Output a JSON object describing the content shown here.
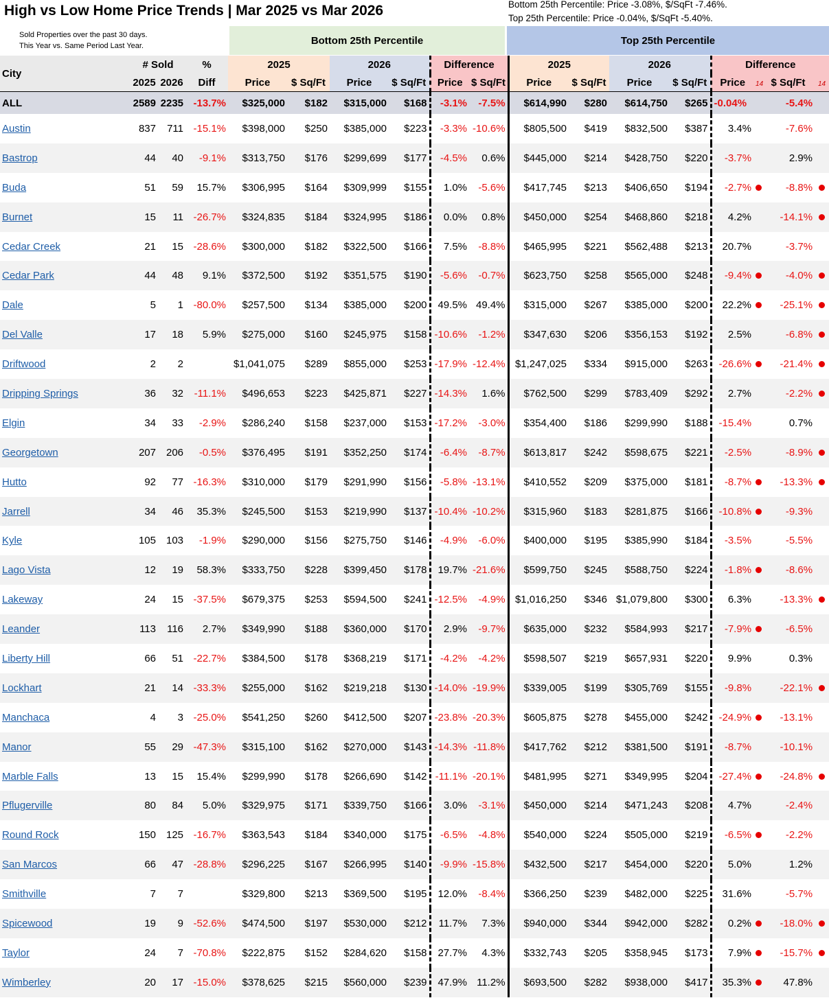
{
  "title": "High vs Low Home Price Trends | Mar 2025 vs Mar 2026",
  "summary": {
    "bottom": "Bottom 25th Percentile: Price -3.08%, $/SqFt -7.46%.",
    "top": "Top 25th Percentile: Price -0.04%, $/SqFt -5.40%."
  },
  "note": {
    "line1": "Sold Properties over the past 30 days.",
    "line2": "This Year vs. Same Period Last Year."
  },
  "bands": {
    "bottom": "Bottom 25th Percentile",
    "top": "Top 25th Percentile"
  },
  "headers": {
    "city": "City",
    "sold": "# Sold",
    "pct": "%",
    "y2025": "2025",
    "y2026": "2026",
    "diff": "Diff",
    "difference": "Difference",
    "price": "Price",
    "sqft": "$ Sq/Ft",
    "flag": "14"
  },
  "colors": {
    "peach": "#fde4d2",
    "blue": "#d6dcea",
    "pink": "#f9c5c7",
    "band_green": "#e2efda",
    "band_blue": "#b4c6e7",
    "link": "#1f5ea8",
    "negative": "#e81515",
    "dot": "#e60000"
  },
  "chart_data": {
    "type": "table",
    "columns": [
      "City",
      "# Sold 2025",
      "# Sold 2026",
      "% Diff",
      "Bottom 2025 Price",
      "Bottom 2025 $ Sq/Ft",
      "Bottom 2026 Price",
      "Bottom 2026 $ Sq/Ft",
      "Bottom Diff Price",
      "Bottom Diff $ Sq/Ft",
      "Top 2025 Price",
      "Top 2025 $ Sq/Ft",
      "Top 2026 Price",
      "Top 2026 $ Sq/Ft",
      "Top Diff Price",
      "Top Diff Price Flag",
      "Top Diff $ Sq/Ft",
      "Top Diff $ Sq/Ft Flag"
    ],
    "all_row": [
      "ALL",
      "2589",
      "2235",
      "-13.7%",
      "$325,000",
      "$182",
      "$315,000",
      "$168",
      "-3.1%",
      "-7.5%",
      "$614,990",
      "$280",
      "$614,750",
      "$265",
      "-0.04%",
      false,
      "-5.4%",
      false
    ],
    "rows": [
      [
        "Austin",
        "837",
        "711",
        "-15.1%",
        "$398,000",
        "$250",
        "$385,000",
        "$223",
        "-3.3%",
        "-10.6%",
        "$805,500",
        "$419",
        "$832,500",
        "$387",
        "3.4%",
        false,
        "-7.6%",
        false
      ],
      [
        "Bastrop",
        "44",
        "40",
        "-9.1%",
        "$313,750",
        "$176",
        "$299,699",
        "$177",
        "-4.5%",
        "0.6%",
        "$445,000",
        "$214",
        "$428,750",
        "$220",
        "-3.7%",
        false,
        "2.9%",
        false
      ],
      [
        "Buda",
        "51",
        "59",
        "15.7%",
        "$306,995",
        "$164",
        "$309,999",
        "$155",
        "1.0%",
        "-5.6%",
        "$417,745",
        "$213",
        "$406,650",
        "$194",
        "-2.7%",
        true,
        "-8.8%",
        true
      ],
      [
        "Burnet",
        "15",
        "11",
        "-26.7%",
        "$324,835",
        "$184",
        "$324,995",
        "$186",
        "0.0%",
        "0.8%",
        "$450,000",
        "$254",
        "$468,860",
        "$218",
        "4.2%",
        false,
        "-14.1%",
        true
      ],
      [
        "Cedar Creek",
        "21",
        "15",
        "-28.6%",
        "$300,000",
        "$182",
        "$322,500",
        "$166",
        "7.5%",
        "-8.8%",
        "$465,995",
        "$221",
        "$562,488",
        "$213",
        "20.7%",
        false,
        "-3.7%",
        false
      ],
      [
        "Cedar Park",
        "44",
        "48",
        "9.1%",
        "$372,500",
        "$192",
        "$351,575",
        "$190",
        "-5.6%",
        "-0.7%",
        "$623,750",
        "$258",
        "$565,000",
        "$248",
        "-9.4%",
        true,
        "-4.0%",
        true
      ],
      [
        "Dale",
        "5",
        "1",
        "-80.0%",
        "$257,500",
        "$134",
        "$385,000",
        "$200",
        "49.5%",
        "49.4%",
        "$315,000",
        "$267",
        "$385,000",
        "$200",
        "22.2%",
        true,
        "-25.1%",
        true
      ],
      [
        "Del Valle",
        "17",
        "18",
        "5.9%",
        "$275,000",
        "$160",
        "$245,975",
        "$158",
        "-10.6%",
        "-1.2%",
        "$347,630",
        "$206",
        "$356,153",
        "$192",
        "2.5%",
        false,
        "-6.8%",
        true
      ],
      [
        "Driftwood",
        "2",
        "2",
        "",
        "$1,041,075",
        "$289",
        "$855,000",
        "$253",
        "-17.9%",
        "-12.4%",
        "$1,247,025",
        "$334",
        "$915,000",
        "$263",
        "-26.6%",
        true,
        "-21.4%",
        true
      ],
      [
        "Dripping Springs",
        "36",
        "32",
        "-11.1%",
        "$496,653",
        "$223",
        "$425,871",
        "$227",
        "-14.3%",
        "1.6%",
        "$762,500",
        "$299",
        "$783,409",
        "$292",
        "2.7%",
        false,
        "-2.2%",
        true
      ],
      [
        "Elgin",
        "34",
        "33",
        "-2.9%",
        "$286,240",
        "$158",
        "$237,000",
        "$153",
        "-17.2%",
        "-3.0%",
        "$354,400",
        "$186",
        "$299,990",
        "$188",
        "-15.4%",
        false,
        "0.7%",
        false
      ],
      [
        "Georgetown",
        "207",
        "206",
        "-0.5%",
        "$376,495",
        "$191",
        "$352,250",
        "$174",
        "-6.4%",
        "-8.7%",
        "$613,817",
        "$242",
        "$598,675",
        "$221",
        "-2.5%",
        false,
        "-8.9%",
        true
      ],
      [
        "Hutto",
        "92",
        "77",
        "-16.3%",
        "$310,000",
        "$179",
        "$291,990",
        "$156",
        "-5.8%",
        "-13.1%",
        "$410,552",
        "$209",
        "$375,000",
        "$181",
        "-8.7%",
        true,
        "-13.3%",
        true
      ],
      [
        "Jarrell",
        "34",
        "46",
        "35.3%",
        "$245,500",
        "$153",
        "$219,990",
        "$137",
        "-10.4%",
        "-10.2%",
        "$315,960",
        "$183",
        "$281,875",
        "$166",
        "-10.8%",
        true,
        "-9.3%",
        false
      ],
      [
        "Kyle",
        "105",
        "103",
        "-1.9%",
        "$290,000",
        "$156",
        "$275,750",
        "$146",
        "-4.9%",
        "-6.0%",
        "$400,000",
        "$195",
        "$385,990",
        "$184",
        "-3.5%",
        false,
        "-5.5%",
        false
      ],
      [
        "Lago Vista",
        "12",
        "19",
        "58.3%",
        "$333,750",
        "$228",
        "$399,450",
        "$178",
        "19.7%",
        "-21.6%",
        "$599,750",
        "$245",
        "$588,750",
        "$224",
        "-1.8%",
        true,
        "-8.6%",
        false
      ],
      [
        "Lakeway",
        "24",
        "15",
        "-37.5%",
        "$679,375",
        "$253",
        "$594,500",
        "$241",
        "-12.5%",
        "-4.9%",
        "$1,016,250",
        "$346",
        "$1,079,800",
        "$300",
        "6.3%",
        false,
        "-13.3%",
        true
      ],
      [
        "Leander",
        "113",
        "116",
        "2.7%",
        "$349,990",
        "$188",
        "$360,000",
        "$170",
        "2.9%",
        "-9.7%",
        "$635,000",
        "$232",
        "$584,993",
        "$217",
        "-7.9%",
        true,
        "-6.5%",
        false
      ],
      [
        "Liberty Hill",
        "66",
        "51",
        "-22.7%",
        "$384,500",
        "$178",
        "$368,219",
        "$171",
        "-4.2%",
        "-4.2%",
        "$598,507",
        "$219",
        "$657,931",
        "$220",
        "9.9%",
        false,
        "0.3%",
        false
      ],
      [
        "Lockhart",
        "21",
        "14",
        "-33.3%",
        "$255,000",
        "$162",
        "$219,218",
        "$130",
        "-14.0%",
        "-19.9%",
        "$339,005",
        "$199",
        "$305,769",
        "$155",
        "-9.8%",
        false,
        "-22.1%",
        true
      ],
      [
        "Manchaca",
        "4",
        "3",
        "-25.0%",
        "$541,250",
        "$260",
        "$412,500",
        "$207",
        "-23.8%",
        "-20.3%",
        "$605,875",
        "$278",
        "$455,000",
        "$242",
        "-24.9%",
        true,
        "-13.1%",
        false
      ],
      [
        "Manor",
        "55",
        "29",
        "-47.3%",
        "$315,100",
        "$162",
        "$270,000",
        "$143",
        "-14.3%",
        "-11.8%",
        "$417,762",
        "$212",
        "$381,500",
        "$191",
        "-8.7%",
        false,
        "-10.1%",
        false
      ],
      [
        "Marble Falls",
        "13",
        "15",
        "15.4%",
        "$299,990",
        "$178",
        "$266,690",
        "$142",
        "-11.1%",
        "-20.1%",
        "$481,995",
        "$271",
        "$349,995",
        "$204",
        "-27.4%",
        true,
        "-24.8%",
        true
      ],
      [
        "Pflugerville",
        "80",
        "84",
        "5.0%",
        "$329,975",
        "$171",
        "$339,750",
        "$166",
        "3.0%",
        "-3.1%",
        "$450,000",
        "$214",
        "$471,243",
        "$208",
        "4.7%",
        false,
        "-2.4%",
        false
      ],
      [
        "Round Rock",
        "150",
        "125",
        "-16.7%",
        "$363,543",
        "$184",
        "$340,000",
        "$175",
        "-6.5%",
        "-4.8%",
        "$540,000",
        "$224",
        "$505,000",
        "$219",
        "-6.5%",
        true,
        "-2.2%",
        false
      ],
      [
        "San Marcos",
        "66",
        "47",
        "-28.8%",
        "$296,225",
        "$167",
        "$266,995",
        "$140",
        "-9.9%",
        "-15.8%",
        "$432,500",
        "$217",
        "$454,000",
        "$220",
        "5.0%",
        false,
        "1.2%",
        false
      ],
      [
        "Smithville",
        "7",
        "7",
        "",
        "$329,800",
        "$213",
        "$369,500",
        "$195",
        "12.0%",
        "-8.4%",
        "$366,250",
        "$239",
        "$482,000",
        "$225",
        "31.6%",
        false,
        "-5.7%",
        false
      ],
      [
        "Spicewood",
        "19",
        "9",
        "-52.6%",
        "$474,500",
        "$197",
        "$530,000",
        "$212",
        "11.7%",
        "7.3%",
        "$940,000",
        "$344",
        "$942,000",
        "$282",
        "0.2%",
        true,
        "-18.0%",
        true
      ],
      [
        "Taylor",
        "24",
        "7",
        "-70.8%",
        "$222,875",
        "$152",
        "$284,620",
        "$158",
        "27.7%",
        "4.3%",
        "$332,743",
        "$205",
        "$358,945",
        "$173",
        "7.9%",
        true,
        "-15.7%",
        true
      ],
      [
        "Wimberley",
        "20",
        "17",
        "-15.0%",
        "$378,625",
        "$215",
        "$560,000",
        "$239",
        "47.9%",
        "11.2%",
        "$693,500",
        "$282",
        "$938,000",
        "$417",
        "35.3%",
        true,
        "47.8%",
        false
      ]
    ]
  }
}
